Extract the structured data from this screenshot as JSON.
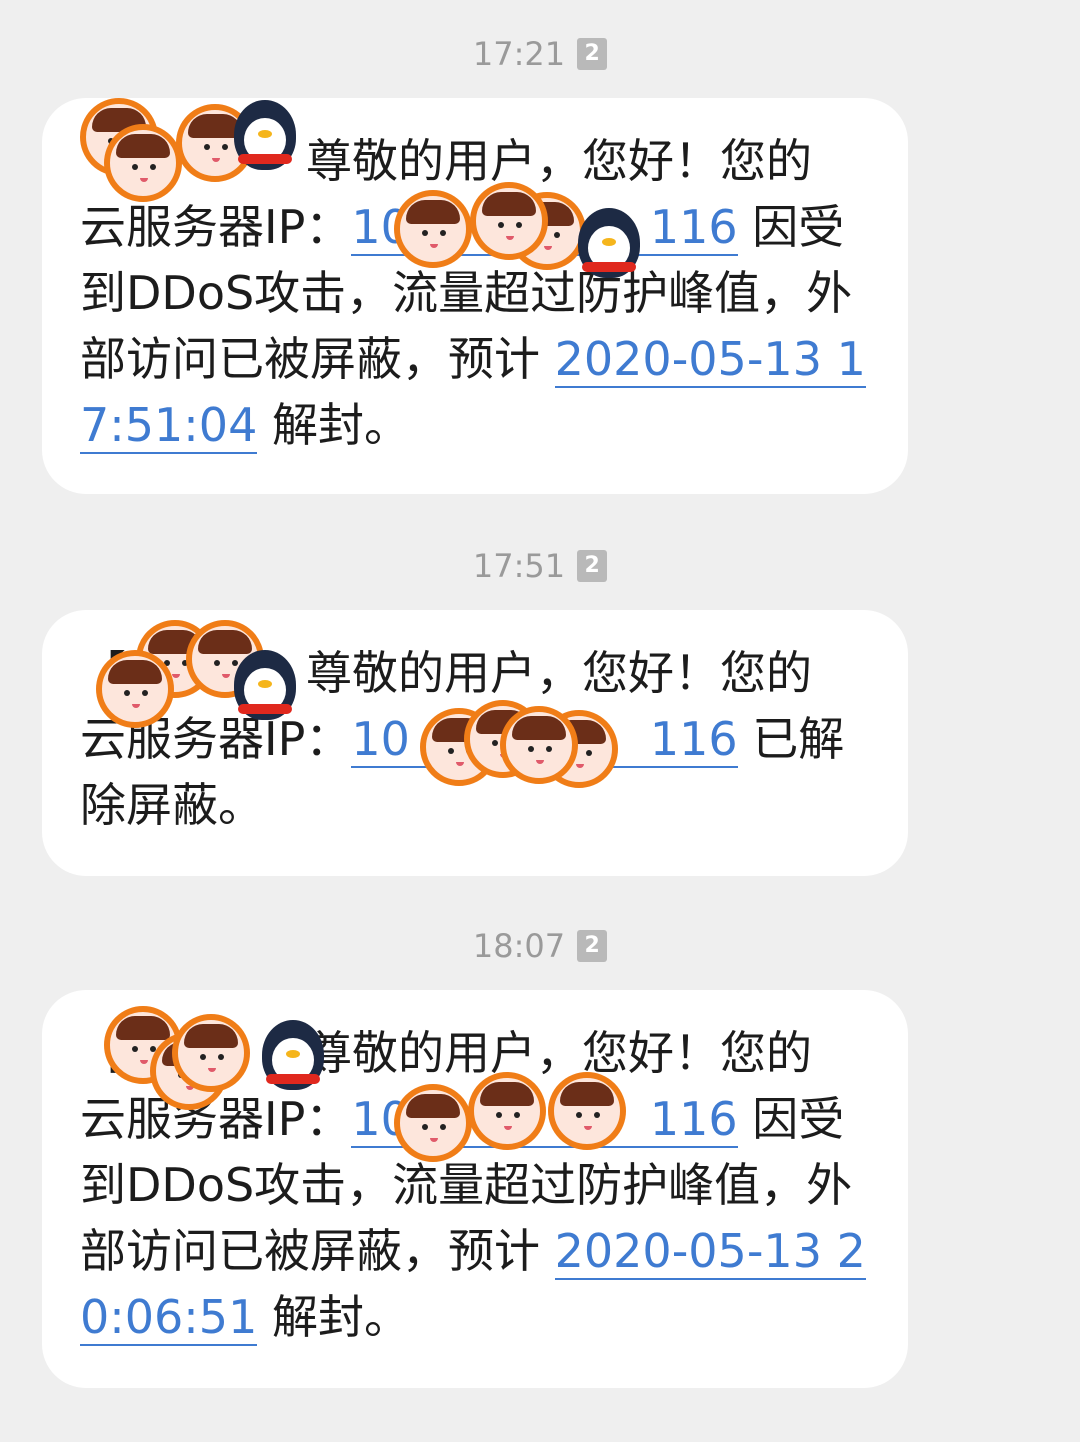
{
  "messages": [
    {
      "time": "17:21",
      "sim": "2",
      "tag": "【",
      "greeting": "尊敬的用户，您好！您的",
      "pre_ip": "云服务器IP：",
      "ip_visible": "10",
      "ip_tail": "116",
      "body": "因受到DDoS攻击，流量超过防护峰值，外部访问已被屏蔽，预计",
      "unblock_time": "2020-05-13 17:51:04",
      "suffix": "解封。"
    },
    {
      "time": "17:51",
      "sim": "2",
      "tag": "【",
      "greeting": "尊敬的用户，您好！您的",
      "pre_ip": "云服务器IP：",
      "ip_visible": "10",
      "ip_tail": "116",
      "body": "已解除屏蔽。"
    },
    {
      "time": "18:07",
      "sim": "2",
      "tag": "【",
      "greeting": "尊敬的用户，您好！您的",
      "pre_ip": "云服务器IP：",
      "ip_visible": "10",
      "ip_tail": "116",
      "body": "因受到DDoS攻击，流量超过防护峰值，外部访问已被屏蔽，预计",
      "unblock_time": "2020-05-13 20:06:51",
      "suffix": "解封。"
    }
  ],
  "colors": {
    "link": "#3f7bd1",
    "timestamp": "#9a9a9a",
    "bubble": "#ffffff",
    "background": "#efefef",
    "sticker_ring": "#f07d17"
  },
  "icons": [
    "sim-2-icon",
    "avatar-sticker-icon",
    "penguin-sticker-icon"
  ]
}
